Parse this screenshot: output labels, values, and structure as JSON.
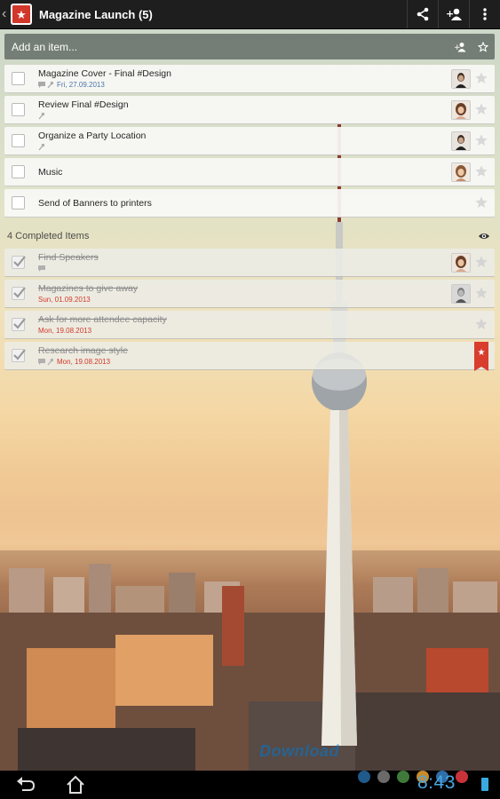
{
  "app": {
    "title": "Magazine Launch (5)",
    "logo_glyph": "★",
    "back_icon": "chevron-left-icon",
    "actions": [
      "share-icon",
      "add-person-icon",
      "overflow-menu-icon"
    ]
  },
  "add_item": {
    "placeholder": "Add an item...",
    "assign_icon": "person-add-icon",
    "star_icon": "star-outline-icon"
  },
  "tasks": [
    {
      "title": "Magazine Cover - Final #Design",
      "has_note": true,
      "has_attachment": true,
      "due": "Fri, 27.09.2013",
      "avatar": "man-dark",
      "starred": false
    },
    {
      "title": "Review Final #Design",
      "has_note": false,
      "has_attachment": true,
      "due": "",
      "avatar": "woman-light",
      "starred": false
    },
    {
      "title": "Organize a Party Location",
      "has_note": false,
      "has_attachment": true,
      "due": "",
      "avatar": "man-dark",
      "starred": false
    },
    {
      "title": "Music",
      "has_note": false,
      "has_attachment": false,
      "due": "",
      "avatar": "woman-brown",
      "starred": false
    },
    {
      "title": "Send of Banners to printers",
      "has_note": false,
      "has_attachment": false,
      "due": "",
      "avatar": "",
      "starred": false
    }
  ],
  "completed": {
    "label": "4 Completed Items",
    "toggle_icon": "eye-icon",
    "items": [
      {
        "title": "Find Speakers",
        "has_note": true,
        "has_attachment": false,
        "due": "",
        "avatar": "woman-light",
        "starred": false
      },
      {
        "title": "Magazines to give away",
        "has_note": false,
        "has_attachment": false,
        "due": "Sun, 01.09.2013",
        "avatar": "man-gray",
        "starred": false
      },
      {
        "title": "Ask for more attendee capacity",
        "has_note": false,
        "has_attachment": false,
        "due": "Mon, 19.08.2013",
        "avatar": "",
        "starred": false
      },
      {
        "title": "Research image style",
        "has_note": true,
        "has_attachment": true,
        "due": "Mon, 19.08.2013",
        "avatar": "",
        "starred": true
      }
    ]
  },
  "watermark": "Download",
  "system": {
    "clock": "8:43",
    "dot_colors": [
      "#1f5a8a",
      "#6a6a6a",
      "#3f7a3a",
      "#c88a2a",
      "#2f6ea8",
      "#c8333a"
    ],
    "accent": "#4aa6de"
  }
}
